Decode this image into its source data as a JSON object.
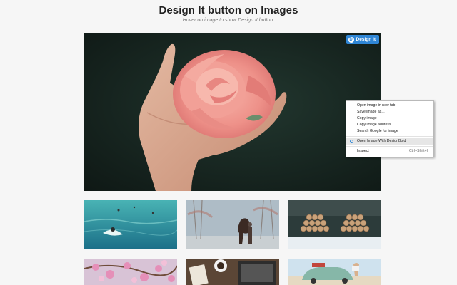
{
  "page": {
    "title": "Design It button on Images",
    "subtitle": "Hover on image to show Design It button."
  },
  "hero": {
    "design_it_label": "Design It",
    "design_it_logo": "D",
    "accent_color": "#2f86d6"
  },
  "context_menu": {
    "items": [
      {
        "label": "Open image in new tab",
        "shortcut": ""
      },
      {
        "label": "Save image as...",
        "shortcut": ""
      },
      {
        "label": "Copy image",
        "shortcut": ""
      },
      {
        "label": "Copy image address",
        "shortcut": ""
      },
      {
        "label": "Search Google for image",
        "shortcut": ""
      },
      {
        "label": "Open Image With DesignBold",
        "shortcut": ""
      },
      {
        "label": "Inspect",
        "shortcut": "Ctrl+Shift+I"
      }
    ]
  },
  "gallery": {
    "thumbnails": [
      {
        "subject": "surfer-ocean"
      },
      {
        "subject": "horse-winter-forest"
      },
      {
        "subject": "log-piles-snow"
      },
      {
        "subject": "pink-blossoms"
      },
      {
        "subject": "desk-coffee-laptop"
      },
      {
        "subject": "vintage-car-beach"
      }
    ]
  }
}
